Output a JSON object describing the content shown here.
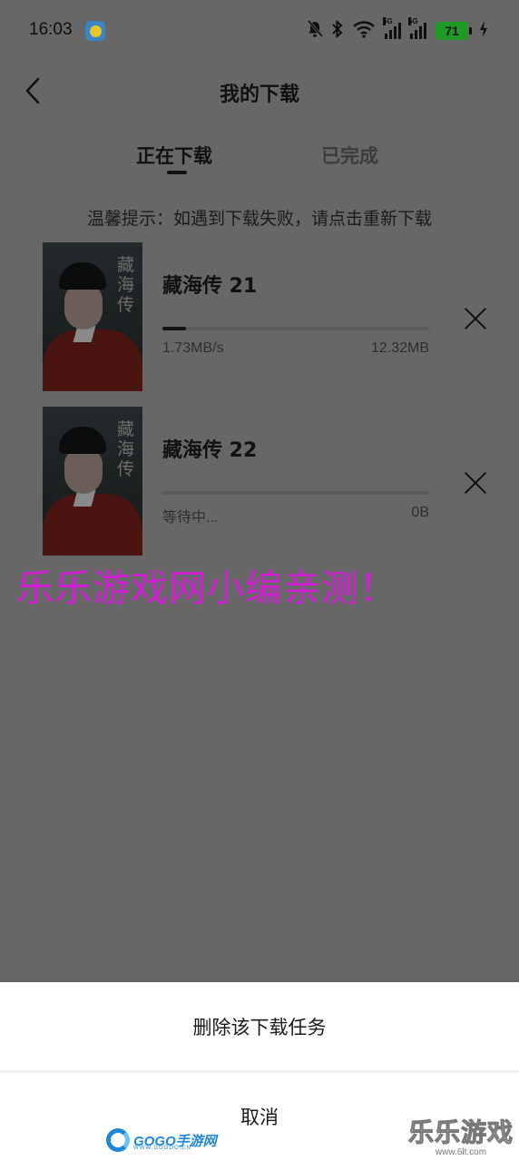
{
  "status_bar": {
    "time": "16:03",
    "signal1_label": "5G",
    "signal2_label": "5G",
    "battery": "71",
    "icons": [
      "app-notification-icon",
      "mute-bell-icon",
      "bluetooth-icon",
      "wifi-icon",
      "signal-icon",
      "signal-icon",
      "battery-icon",
      "charging-icon"
    ]
  },
  "header": {
    "title": "我的下载",
    "back_icon": "chevron-left-icon"
  },
  "tabs": [
    {
      "label": "正在下载",
      "active": true
    },
    {
      "label": "已完成",
      "active": false
    }
  ],
  "hint": "温馨提示：如遇到下载失败，请点击重新下载",
  "downloads": [
    {
      "title": "藏海传 21",
      "poster_text": "藏海传",
      "speed": "1.73MB/s",
      "size": "12.32MB",
      "progress": 0.09
    },
    {
      "title": "藏海传 22",
      "poster_text": "藏海传",
      "speed": "等待中...",
      "size": "0B",
      "progress": 0
    }
  ],
  "watermark": "乐乐游戏网小编亲测！",
  "sheet": {
    "delete_label": "删除该下载任务",
    "cancel_label": "取消"
  },
  "branding": {
    "left": "GOGO手游网",
    "left_url": "WWW.GOGOO.CN",
    "right": "乐乐游戏",
    "right_url": "www.6lt.com"
  },
  "colors": {
    "overlay_dim": "#676767",
    "watermark": "#d21fd5",
    "battery": "#1e9b25",
    "sheet_bg": "#ffffff"
  }
}
